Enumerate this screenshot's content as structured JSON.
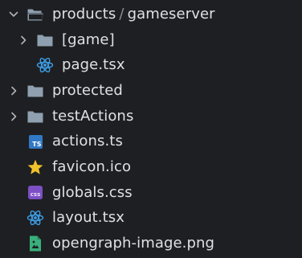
{
  "colors": {
    "background": "#1e1f22",
    "text": "#dfe1e5",
    "folder": "#8fa0b0",
    "chevron": "#b0b3b8",
    "react": "#3d9ee6",
    "typescript": "#3178c6",
    "favicon": "#f0c22b",
    "css": "#7d4fc4",
    "image": "#39b07c"
  },
  "tree": {
    "root": {
      "label_part1": "products",
      "separator": "/",
      "label_part2": "gameserver",
      "expanded": true,
      "icon": "folder-open-icon"
    },
    "items": [
      {
        "label": "[game]",
        "type": "folder",
        "icon": "folder-icon",
        "expanded": false
      },
      {
        "label": "page.tsx",
        "type": "file",
        "icon": "react-icon"
      },
      {
        "label": "protected",
        "type": "folder",
        "icon": "folder-icon",
        "expanded": false
      },
      {
        "label": "testActions",
        "type": "folder",
        "icon": "folder-icon",
        "expanded": false
      },
      {
        "label": "actions.ts",
        "type": "file",
        "icon": "typescript-icon",
        "badge": "TS"
      },
      {
        "label": "favicon.ico",
        "type": "file",
        "icon": "star-icon"
      },
      {
        "label": "globals.css",
        "type": "file",
        "icon": "css-icon",
        "badge": "css"
      },
      {
        "label": "layout.tsx",
        "type": "file",
        "icon": "react-icon"
      },
      {
        "label": "opengraph-image.png",
        "type": "file",
        "icon": "image-icon"
      }
    ]
  }
}
